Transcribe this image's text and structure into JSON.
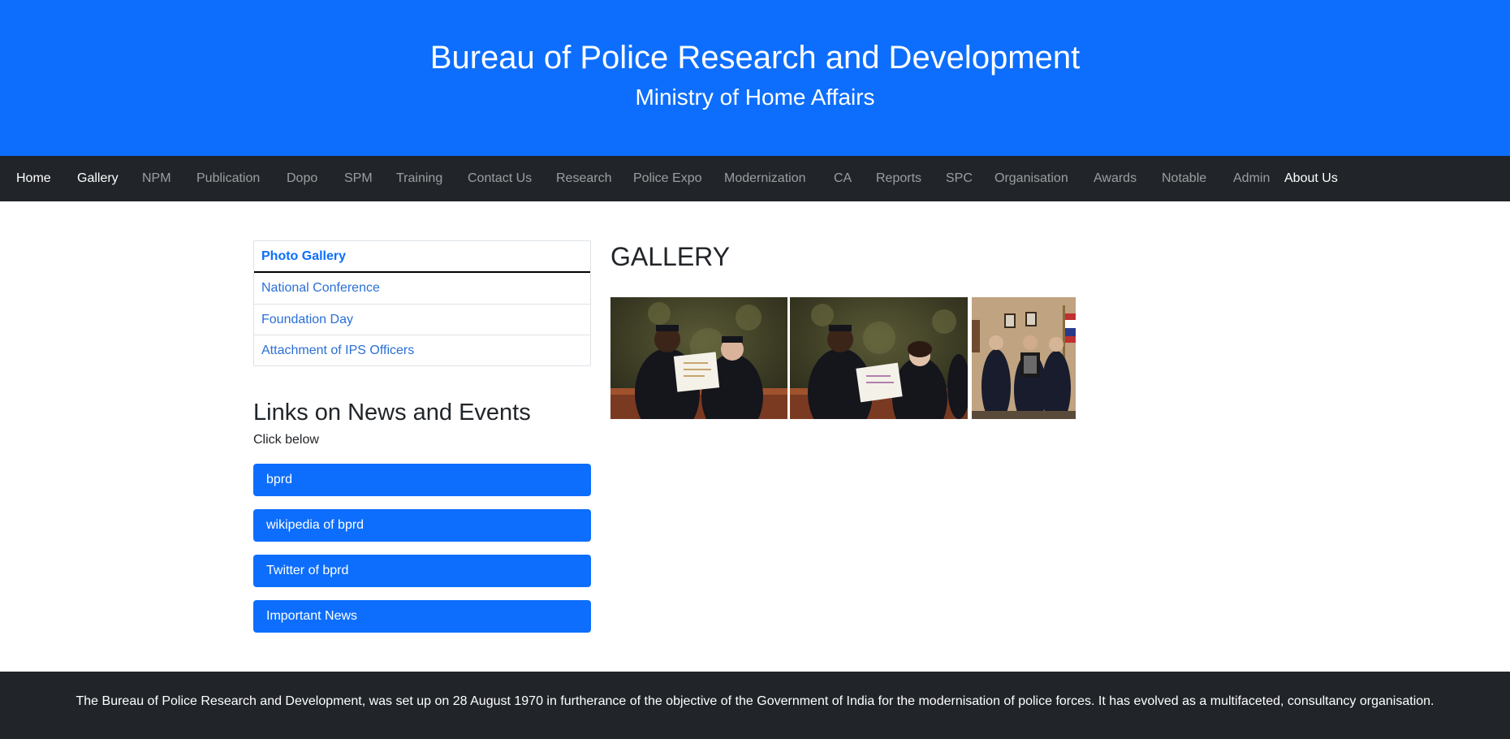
{
  "header": {
    "title": "Bureau of Police Research and Development",
    "subtitle": "Ministry of Home Affairs"
  },
  "nav": {
    "items": [
      {
        "label": "Home"
      },
      {
        "label": "Gallery"
      },
      {
        "label": "NPM"
      },
      {
        "label": "Publication"
      },
      {
        "label": "Dopo"
      },
      {
        "label": "SPM"
      },
      {
        "label": "Training"
      },
      {
        "label": "Contact Us"
      },
      {
        "label": "Research"
      },
      {
        "label": "Police Expo"
      },
      {
        "label": "Modernization"
      },
      {
        "label": "CA"
      },
      {
        "label": "Reports"
      },
      {
        "label": "SPC"
      },
      {
        "label": "Organisation"
      },
      {
        "label": "Awards"
      },
      {
        "label": "Notable"
      },
      {
        "label": "Admin"
      },
      {
        "label": "About Us"
      }
    ]
  },
  "sidebar": {
    "heading": "Photo Gallery",
    "items": [
      {
        "label": "National Conference"
      },
      {
        "label": "Foundation Day"
      },
      {
        "label": "Attachment of IPS Officers"
      }
    ]
  },
  "links_section": {
    "title": "Links on News and Events",
    "hint": "Click below",
    "buttons": [
      {
        "label": "bprd"
      },
      {
        "label": "wikipedia of bprd"
      },
      {
        "label": "Twitter of bprd"
      },
      {
        "label": "Important News"
      }
    ]
  },
  "gallery": {
    "title": "GALLERY"
  },
  "footer": {
    "text": "The Bureau of Police Research and Development, was set up on 28 August 1970 in furtherance of the objective of the Government of India for the modernisation of police forces. It has evolved as a multifaceted, consultancy organisation."
  },
  "colors": {
    "brand_blue": "#0d6efd",
    "navbar_dark": "#212529",
    "footer_dark": "#212529"
  }
}
